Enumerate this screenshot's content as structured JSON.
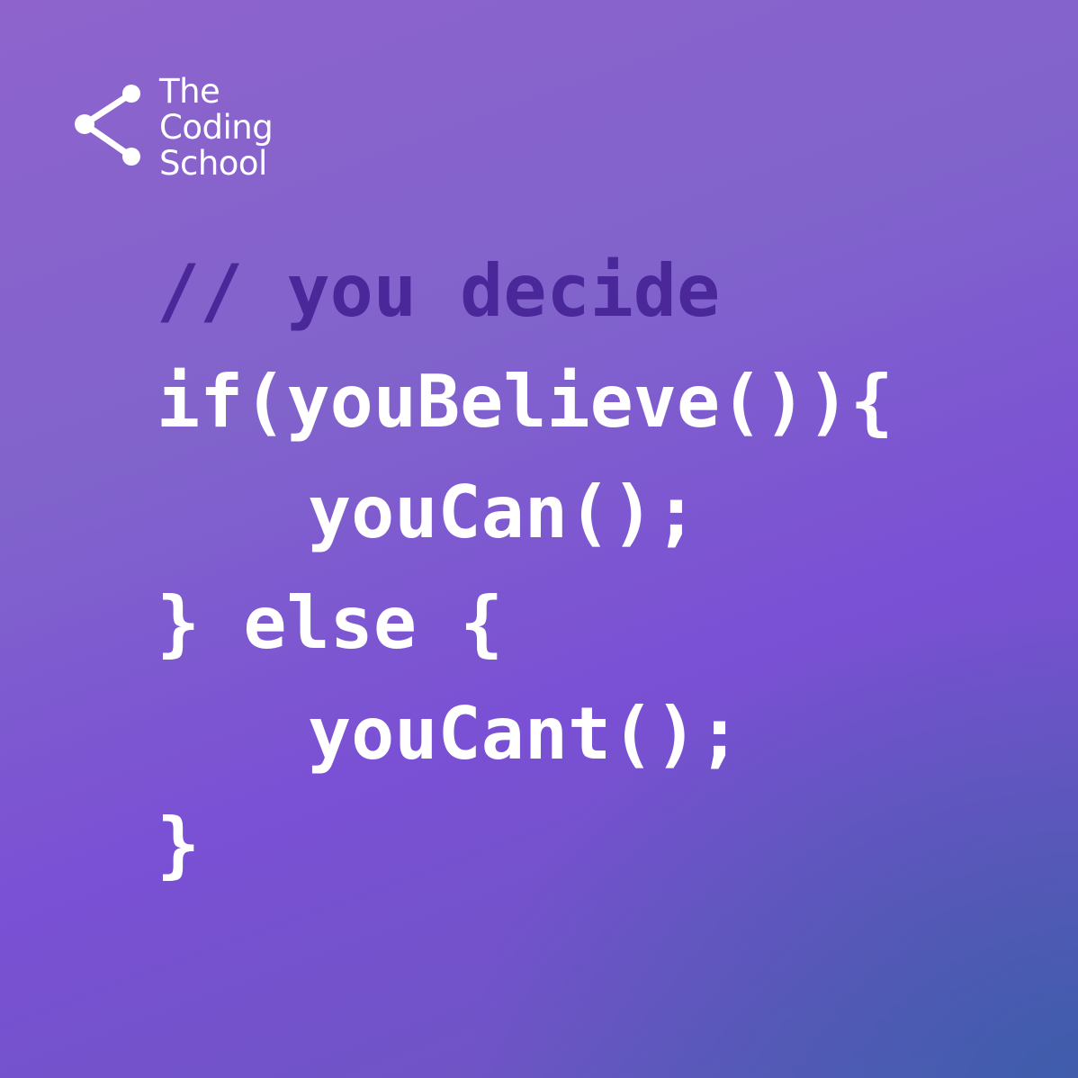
{
  "brand": {
    "logo_lines": [
      "The",
      "Coding",
      "School"
    ],
    "logo_icon": "share-node-icon",
    "text_color": "#ffffff"
  },
  "code": {
    "comment": "// you decide",
    "lines": [
      "if(youBelieve()){",
      "youCan();",
      "} else {",
      "youCant();",
      "}"
    ],
    "comment_color": "#4a2899",
    "code_color": "#ffffff"
  },
  "colors": {
    "background_top": "#8e63cc",
    "background_bottom_right": "#3e5caa"
  }
}
